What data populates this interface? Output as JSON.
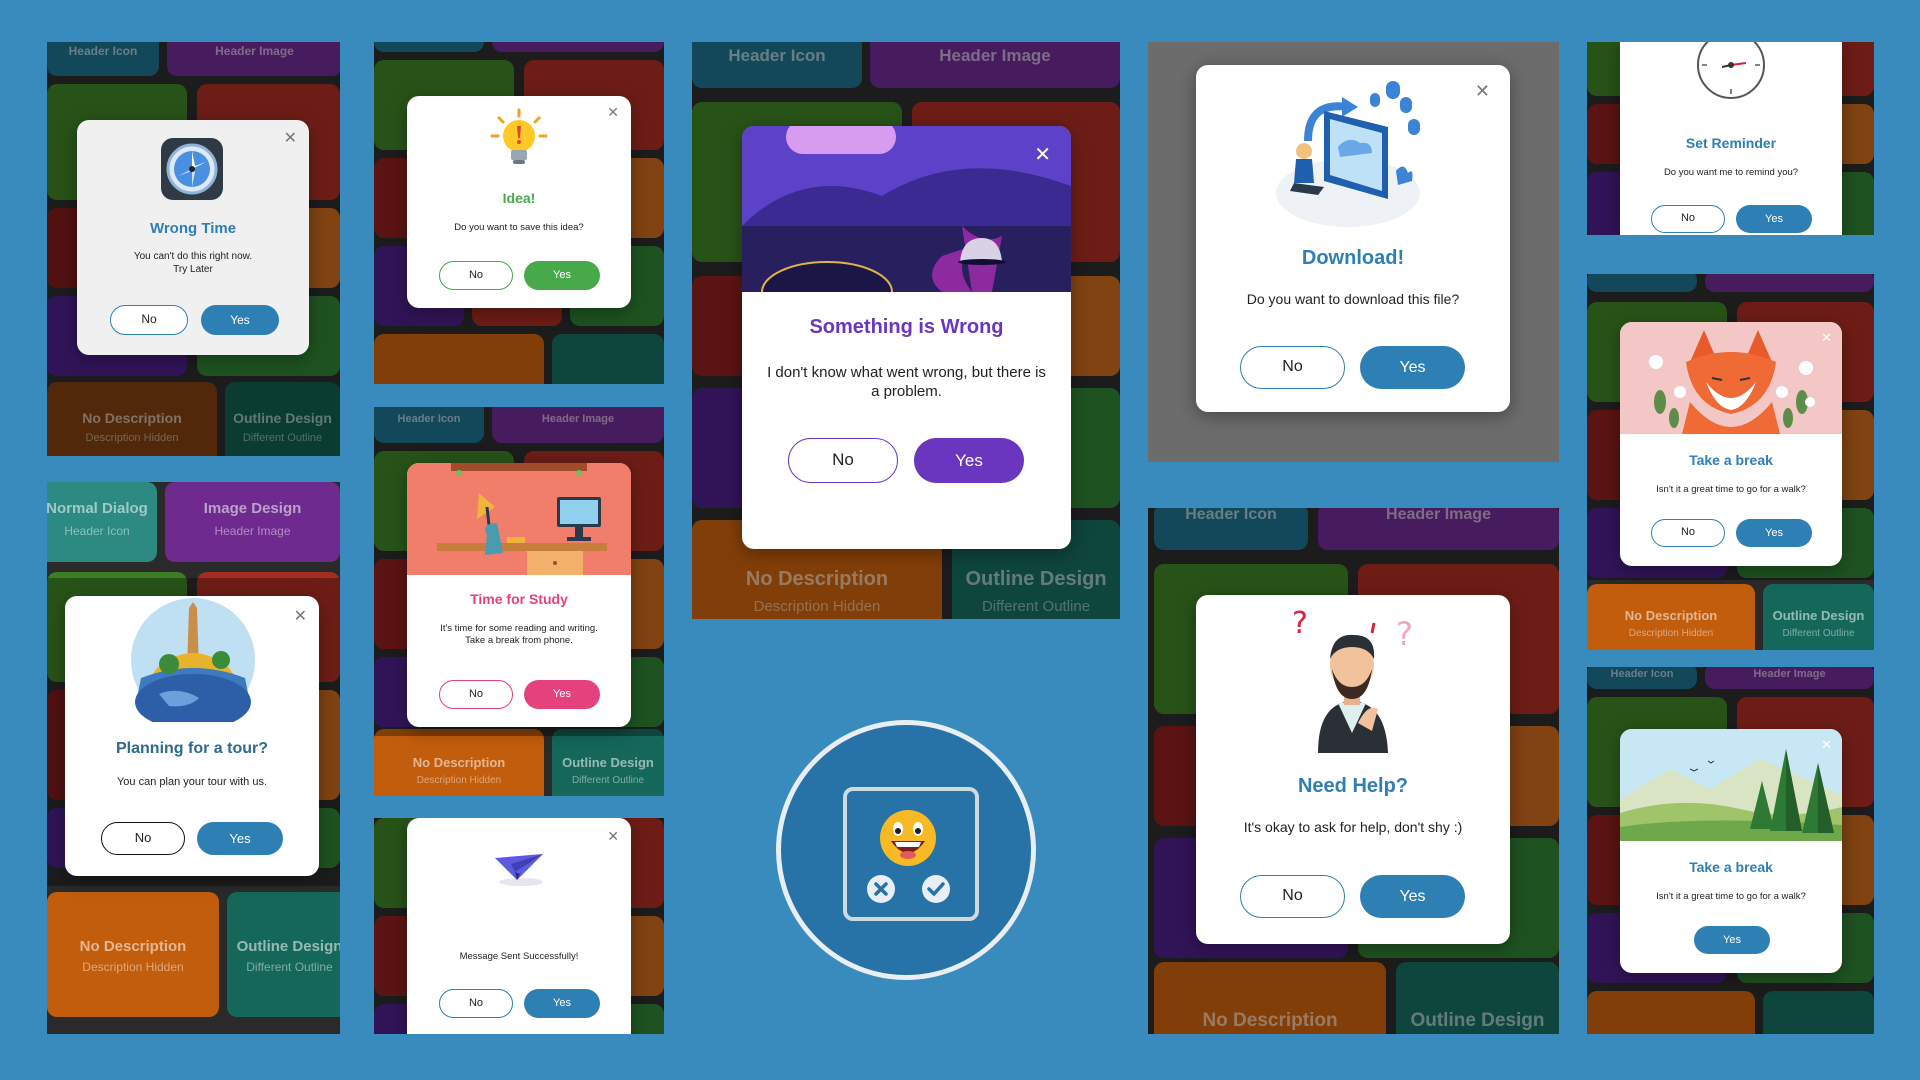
{
  "colors": {
    "background": "#3a8bbd",
    "blue": "#2e7fb4",
    "green": "#47a94a",
    "pink": "#e5417c",
    "purple": "#6a36c0",
    "teal_dark": "#2c6b8e"
  },
  "tiles": {
    "header_icon": "Header Icon",
    "header_image": "Header Image",
    "normal_dialog": "Normal Dialog",
    "image_design": "Image Design",
    "no_description": "No Description",
    "description_hidden": "Description Hidden",
    "outline_design": "Outline Design",
    "different_outline": "Different Outline"
  },
  "dialogs": {
    "wrong_time": {
      "title": "Wrong Time",
      "msg1": "You can't do this right now.",
      "msg2": "Try Later",
      "no": "No",
      "yes": "Yes",
      "icon": "clock-icon"
    },
    "idea": {
      "title": "Idea!",
      "msg": "Do you want to save this idea?",
      "no": "No",
      "yes": "Yes",
      "icon": "lightbulb-icon"
    },
    "planning": {
      "title": "Planning for a tour?",
      "msg": "You can plan your tour with us.",
      "no": "No",
      "yes": "Yes",
      "icon": "globe-icon"
    },
    "study": {
      "title": "Time for Study",
      "msg1": "It's time for some reading and writing.",
      "msg2": "Take a break from phone.",
      "no": "No",
      "yes": "Yes"
    },
    "message_sent": {
      "msg": "Message Sent Successfully!",
      "no": "No",
      "yes": "Yes",
      "icon": "paper-plane-icon"
    },
    "something_wrong": {
      "title": "Something is Wrong",
      "msg1": "I don't know what went wrong, but there is",
      "msg2": "a problem.",
      "no": "No",
      "yes": "Yes"
    },
    "download": {
      "title": "Download!",
      "msg": "Do you want to download this file?",
      "no": "No",
      "yes": "Yes"
    },
    "need_help": {
      "title": "Need Help?",
      "msg": "It's okay to ask for help, don't shy :)",
      "no": "No",
      "yes": "Yes"
    },
    "set_reminder": {
      "title": "Set Reminder",
      "msg": "Do you want me to remind you?",
      "no": "No",
      "yes": "Yes",
      "icon": "stopwatch-icon"
    },
    "take_break_fox": {
      "title": "Take a break",
      "msg": "Isn't it a great time to go for a walk?",
      "no": "No",
      "yes": "Yes"
    },
    "take_break_trees": {
      "title": "Take a break",
      "msg": "Isn't it a great time to go for a walk?",
      "yes": "Yes"
    }
  },
  "logo": {
    "icon": "smiley-face-icon",
    "decline_icon": "x-icon",
    "accept_icon": "checkmark-icon"
  }
}
